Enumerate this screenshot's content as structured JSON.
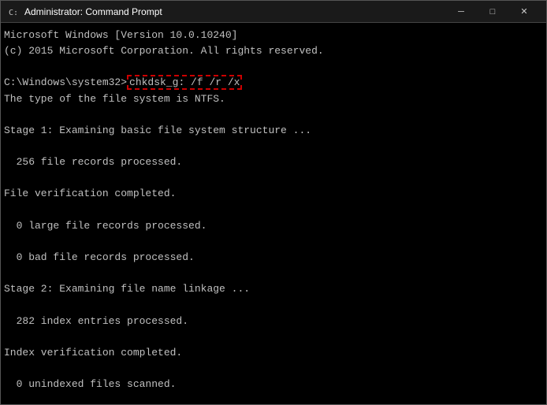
{
  "titleBar": {
    "icon": "cmd-icon",
    "title": "Administrator: Command Prompt",
    "minimizeLabel": "─",
    "maximizeLabel": "□",
    "closeLabel": "✕"
  },
  "console": {
    "lines": [
      "Microsoft Windows [Version 10.0.10240]",
      "(c) 2015 Microsoft Corporation. All rights reserved.",
      "",
      "C:\\Windows\\system32>",
      "chkdsk_g: /f /r /x",
      "The type of the file system is NTFS.",
      "",
      "Stage 1: Examining basic file system structure ...",
      "",
      "  256 file records processed.",
      "",
      "File verification completed.",
      "",
      "  0 large file records processed.",
      "",
      "  0 bad file records processed.",
      "",
      "Stage 2: Examining file name linkage ...",
      "",
      "  282 index entries processed.",
      "",
      "Index verification completed.",
      "",
      "  0 unindexed files scanned."
    ]
  }
}
